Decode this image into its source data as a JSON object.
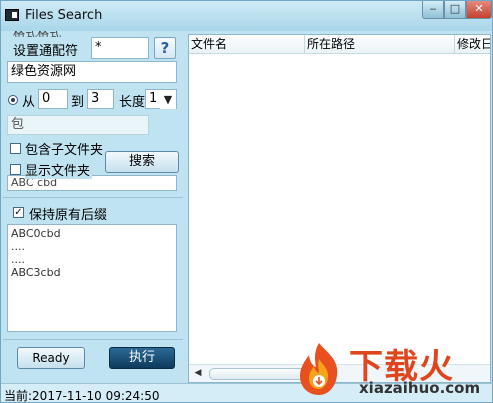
{
  "window": {
    "title": "Files Search",
    "minimize_glyph": "‒",
    "maximize_glyph": "□",
    "close_glyph": "✕"
  },
  "left_panel": {
    "group_title_fragment": "格式格式",
    "wildcard_label": "设置通配符",
    "wildcard_value": "*",
    "help_label": "?",
    "folder_value": "绿色资源网",
    "from_label": "从",
    "from_value": "0",
    "to_label": "到",
    "to_value": "3",
    "length_label": "长度",
    "length_value": "1",
    "contains_value": "包",
    "include_subfolders_label": "包含子文件夹",
    "show_folders_label": "显示文件夹",
    "hidden_preview_text": "ABC cbd",
    "search_button": "搜索",
    "keep_suffix_label": "保持原有后缀",
    "preview_lines": [
      "ABC0cbd",
      "....",
      "....",
      "ABC3cbd"
    ],
    "ready_button": "Ready",
    "run_button": "执行"
  },
  "results_table": {
    "columns": [
      "文件名",
      "所在路径",
      "修改日"
    ],
    "rows": []
  },
  "status_bar": {
    "text": "当前:2017-11-10 09:24:50"
  },
  "watermark": {
    "brand_text": "下载火",
    "url_text": "xiazaihuo.com",
    "brand_color": "#e0461e"
  }
}
